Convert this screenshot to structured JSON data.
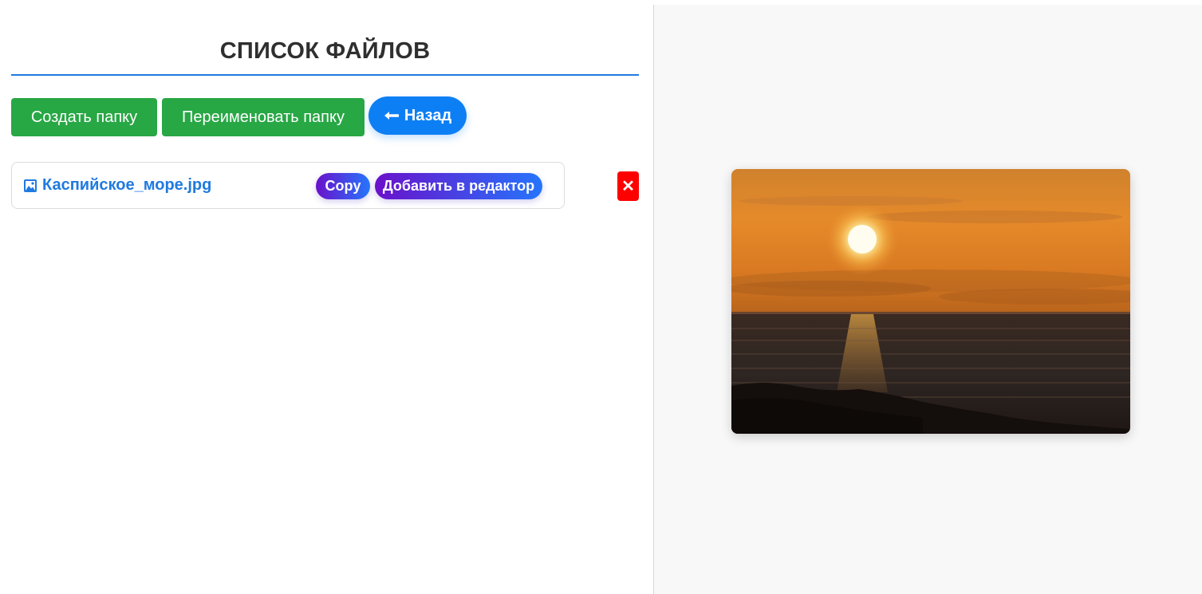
{
  "page": {
    "title": "СПИСОК ФАЙЛОВ"
  },
  "toolbar": {
    "create_folder_label": "Создать папку",
    "rename_folder_label": "Переименовать папку",
    "back_label": "Назад",
    "back_icon": "left-arrow-icon"
  },
  "files": [
    {
      "name": "Каспийское_море.jpg",
      "icon": "image-icon",
      "copy_label": "Copy",
      "add_label": "Добавить в редактор",
      "delete_label": "✕"
    }
  ],
  "preview": {
    "image": "sunset-over-sea-photo"
  },
  "colors": {
    "accent": "#1f7ae0",
    "green": "#28a745",
    "back_blue": "#0d7ff5",
    "delete_red": "#ff0000",
    "pill_gradient_start": "#6a11cb",
    "pill_gradient_end": "#2575fc"
  }
}
